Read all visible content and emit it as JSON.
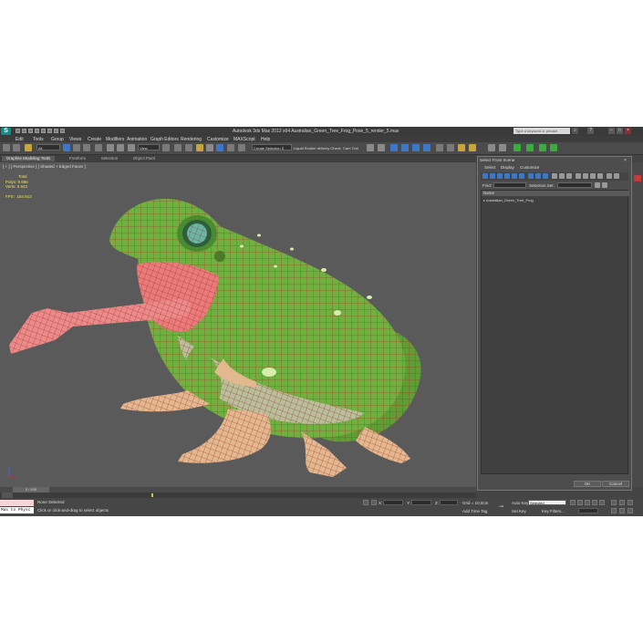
{
  "window": {
    "logo_letter": "S",
    "title": "Autodesk 3ds Max 2012 x64     Australian_Green_Tree_Frog_Pose_5_render_5.max",
    "search_placeholder": "Type a keyword or phrase",
    "minimize": "–",
    "maximize": "□",
    "close": "×"
  },
  "menubar": [
    "Edit",
    "Tools",
    "Group",
    "Views",
    "Create",
    "Modifiers",
    "Animation",
    "Graph Editors",
    "Rendering",
    "Customize",
    "MAXScript",
    "Help"
  ],
  "toolbar": {
    "filter_value": "All",
    "refcoord_value": "View",
    "selection_set_value": "Create Selection S",
    "label_liquid": "Liquid Studio",
    "label_delivery": "+ delivery Check",
    "label_cam": "Cam Tool"
  },
  "ribbon": {
    "tabs": [
      "Graphite Modeling Tools",
      "Freeform",
      "Selection",
      "Object Paint"
    ],
    "active_tab": 0
  },
  "viewport": {
    "label": "[ + ] [ Perspective ] [ Shaded + Edged Faces ]",
    "stats_title": "Total",
    "polys_label": "Polys:",
    "polys_value": "9 896",
    "verts_label": "Verts:",
    "verts_value": "9 842",
    "fps_label": "FPS:",
    "fps_value": "154.912",
    "frame_counter": "0 / 100"
  },
  "status": {
    "maxscript_output": "",
    "maxscript_input": "Max to Physc",
    "selection_status": "None Selected",
    "prompt": "Click or click-and-drag to select objects",
    "x_label": "X:",
    "y_label": "Y:",
    "z_label": "Z:",
    "grid": "Grid = 10,0cm",
    "add_time_tag": "Add Time Tag",
    "auto_key": "Auto Key",
    "set_key": "Set Key",
    "selected_value": "Selected",
    "key_filters": "Key Filters..."
  },
  "dialog": {
    "title": "Select From Scene",
    "close": "×",
    "menus": [
      "Select",
      "Display",
      "Customize"
    ],
    "find_label": "Find:",
    "find_value": "",
    "selection_set_label": "Selection Set:",
    "list_header": "Name",
    "items": [
      "Australian_Green_Tree_Frog"
    ],
    "ok": "OK",
    "cancel": "Cancel"
  },
  "colors": {
    "frog_green": "#6fb13f",
    "wire_red": "#b3202a",
    "mouth_pink": "#e97c7a",
    "viewport_bg": "#5a5a5a",
    "stats_yellow": "#f0e05a"
  },
  "icons": [
    "app-logo-icon",
    "undo-icon",
    "redo-icon",
    "select-icon",
    "move-icon",
    "rotate-icon",
    "scale-icon",
    "render-icon",
    "teapot-icon",
    "magnet-icon",
    "search-icon",
    "help-icon",
    "close-icon",
    "key-icon",
    "play-icon"
  ]
}
